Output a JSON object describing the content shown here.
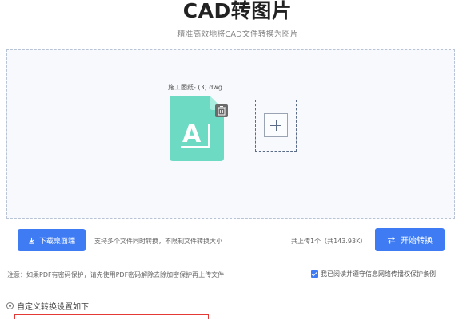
{
  "header": {
    "title": "CAD转图片",
    "subtitle": "精准高效地将CAD文件转换为图片"
  },
  "upload": {
    "file_name": "施工图纸- (3).dwg",
    "file_icon_letter": "A",
    "file_color": "#6ddbc4",
    "add_icon": "plus-icon",
    "delete_icon": "trash-icon"
  },
  "toolbar": {
    "download_label": "下载桌面端",
    "hint": "支持多个文件同时转换，不限制文件转换大小",
    "count": "共上传1个（共143.93K）",
    "start_label": "开始转换",
    "accent": "#3f7cf4"
  },
  "notice": {
    "text": "注意：如果PDF有密码保护，请先使用PDF密码解除去除加密保护再上传文件",
    "agree_label": "我已阅读并遵守信息网络传播权保护条例",
    "agree_checked": "true"
  },
  "settings": {
    "label": "自定义转换设置如下"
  }
}
